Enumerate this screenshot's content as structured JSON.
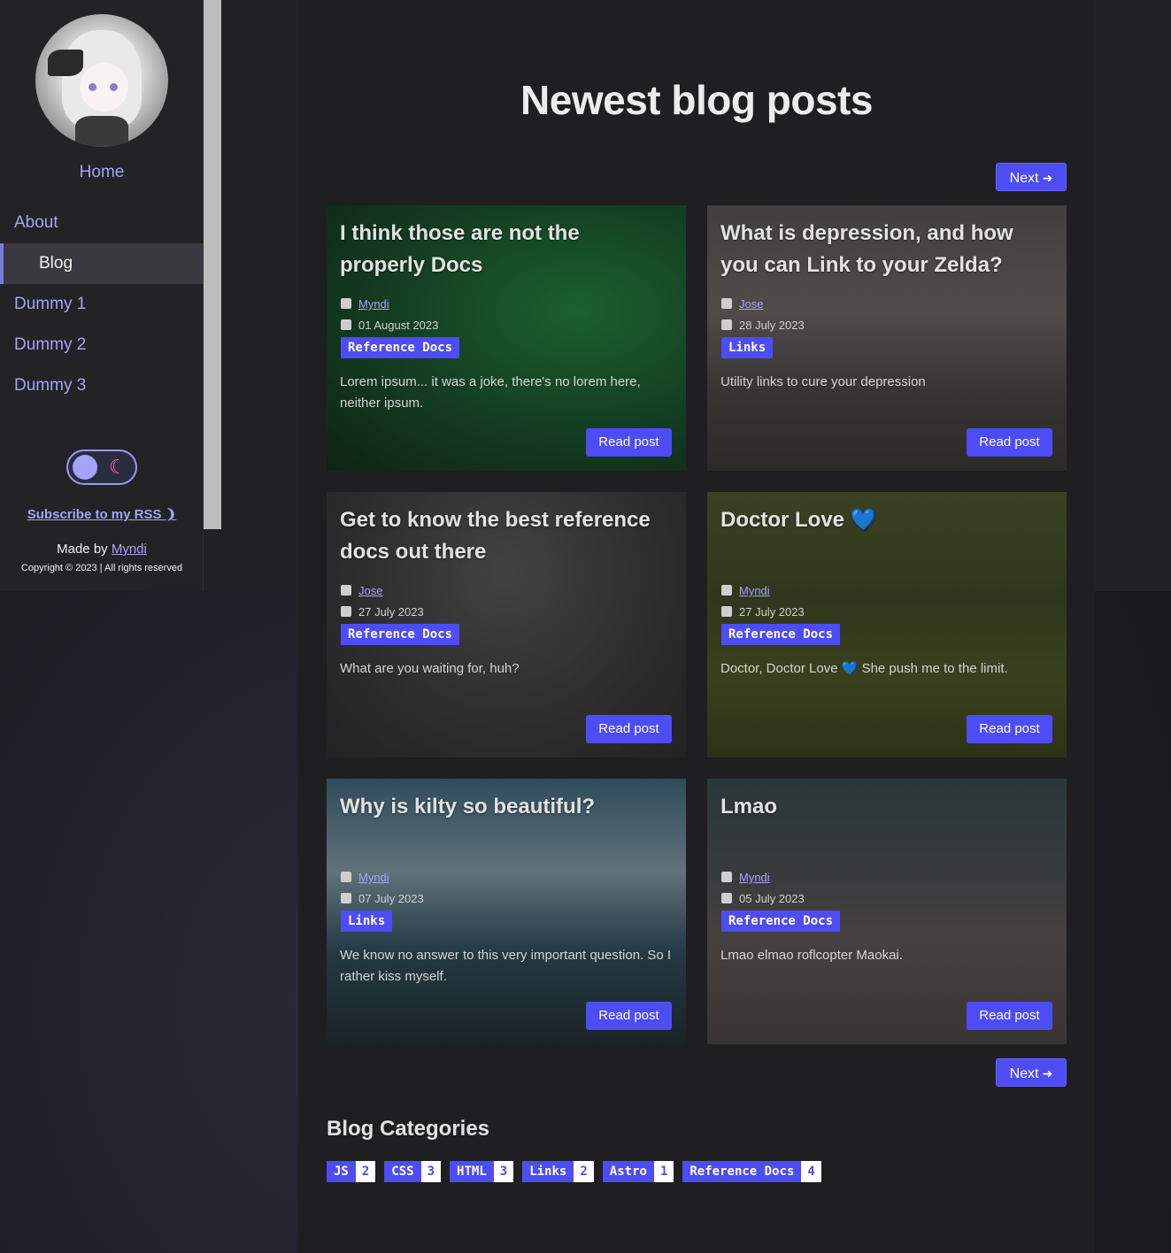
{
  "sidebar": {
    "home_label": "Home",
    "nav": [
      {
        "label": "About"
      },
      {
        "label": "Blog",
        "active": true
      },
      {
        "label": "Dummy 1"
      },
      {
        "label": "Dummy 2"
      },
      {
        "label": "Dummy 3"
      }
    ],
    "rss_label": "Subscribe to my RSS",
    "made_by_prefix": "Made by",
    "made_by_name": "Myndi",
    "copyright": "Copyright © 2023 | All rights reserved"
  },
  "main": {
    "title": "Newest blog posts",
    "next_label": "Next",
    "read_label": "Read post",
    "posts": [
      {
        "title": "I think those are not the properly Docs",
        "author": "Myndi",
        "date": "01 August 2023",
        "tag": "Reference Docs",
        "desc": "Lorem ipsum... it was a joke, there's no lorem here, neither ipsum."
      },
      {
        "title": "What is depression, and how you can Link to your Zelda?",
        "author": "Jose",
        "date": "28 July 2023",
        "tag": "Links",
        "desc": "Utility links to cure your depression"
      },
      {
        "title": "Get to know the best reference docs out there",
        "author": "Jose",
        "date": "27 July 2023",
        "tag": "Reference Docs",
        "desc": "What are you waiting for, huh?"
      },
      {
        "title": "Doctor Love 💙",
        "author": "Myndi",
        "date": "27 July 2023",
        "tag": "Reference Docs",
        "desc": "Doctor, Doctor Love 💙 She push me to the limit."
      },
      {
        "title": "Why is kilty so beautiful?",
        "author": "Myndi",
        "date": "07 July 2023",
        "tag": "Links",
        "desc": "We know no answer to this very important question. So I rather kiss myself."
      },
      {
        "title": "Lmao",
        "author": "Myndi",
        "date": "05 July 2023",
        "tag": "Reference Docs",
        "desc": "Lmao elmao roflcopter Maokai."
      }
    ],
    "categories_title": "Blog Categories",
    "categories": [
      {
        "name": "JS",
        "count": "2"
      },
      {
        "name": "CSS",
        "count": "3"
      },
      {
        "name": "HTML",
        "count": "3"
      },
      {
        "name": "Links",
        "count": "2"
      },
      {
        "name": "Astro",
        "count": "1"
      },
      {
        "name": "Reference Docs",
        "count": "4"
      }
    ]
  },
  "colors": {
    "accent": "#4d4cf5",
    "link": "#a5a4f5"
  }
}
